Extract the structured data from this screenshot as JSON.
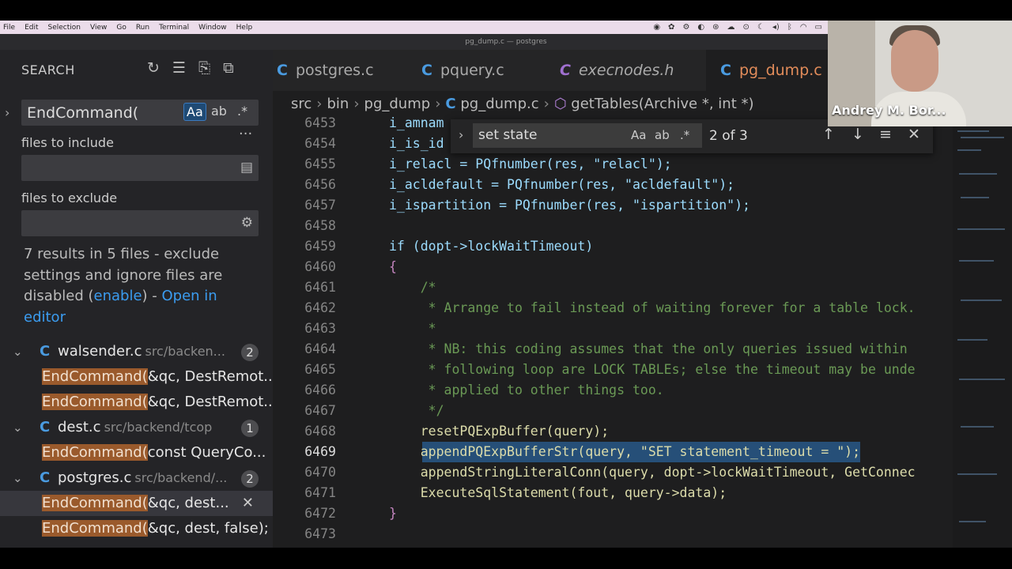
{
  "menubar": {
    "items": [
      "File",
      "Edit",
      "Selection",
      "View",
      "Go",
      "Run",
      "Terminal",
      "Window",
      "Help"
    ]
  },
  "window_title": "pg_dump.c — postgres",
  "sidebar": {
    "header": "SEARCH",
    "search_value": "EndCommand(",
    "match_case": "Aa",
    "whole_word": "ab",
    "regex": ".*",
    "files_to_include_label": "files to include",
    "files_to_exclude_label": "files to exclude",
    "message_prefix": "7 results in 5 files - exclude settings and ignore files are disabled (",
    "enable_link": "enable",
    "message_mid": ") - ",
    "open_link": "Open in editor",
    "results": [
      {
        "name": "walsender.c",
        "path": "src/backen...",
        "count": "2"
      },
      {
        "match_hl": "EndCommand(",
        "match_rest": "&qc, DestRemot..."
      },
      {
        "match_hl": "EndCommand(",
        "match_rest": "&qc, DestRemot..."
      },
      {
        "name": "dest.c",
        "path": "src/backend/tcop",
        "count": "1"
      },
      {
        "match_hl": "EndCommand(",
        "match_rest": "const QueryCo..."
      },
      {
        "name": "postgres.c",
        "path": "src/backend/...",
        "count": "2"
      },
      {
        "match_hl": "EndCommand(",
        "match_rest": "&qc, dest..."
      },
      {
        "match_hl": "EndCommand(",
        "match_rest": "&qc, dest, false);"
      }
    ]
  },
  "tabs": [
    {
      "icon": "C",
      "label": "postgres.c"
    },
    {
      "icon": "C",
      "label": "pquery.c"
    },
    {
      "icon": "C",
      "label": "execnodes.h"
    },
    {
      "icon": "C",
      "label": "pg_dump.c"
    }
  ],
  "breadcrumbs": {
    "parts": [
      "src",
      "bin",
      "pg_dump"
    ],
    "file_icon": "C",
    "file": "pg_dump.c",
    "symbol": "getTables(Archive *, int *)"
  },
  "find": {
    "query": "set state",
    "match_case": "Aa",
    "whole_word": "ab",
    "regex": ".*",
    "count": "2 of 3"
  },
  "code_lines": [
    {
      "n": "6453",
      "t": "i_amnam"
    },
    {
      "n": "6454",
      "t": "i_is_id"
    },
    {
      "n": "6455",
      "t": "i_relacl = PQfnumber(res, \"relacl\");"
    },
    {
      "n": "6456",
      "t": "i_acldefault = PQfnumber(res, \"acldefault\");"
    },
    {
      "n": "6457",
      "t": "i_ispartition = PQfnumber(res, \"ispartition\");"
    },
    {
      "n": "6458",
      "t": ""
    },
    {
      "n": "6459",
      "t": "if (dopt->lockWaitTimeout)"
    },
    {
      "n": "6460",
      "t": "{"
    },
    {
      "n": "6461",
      "t": "    /*"
    },
    {
      "n": "6462",
      "t": "     * Arrange to fail instead of waiting forever for a table lock."
    },
    {
      "n": "6463",
      "t": "     *"
    },
    {
      "n": "6464",
      "t": "     * NB: this coding assumes that the only queries issued within"
    },
    {
      "n": "6465",
      "t": "     * following loop are LOCK TABLEs; else the timeout may be unde"
    },
    {
      "n": "6466",
      "t": "     * applied to other things too."
    },
    {
      "n": "6467",
      "t": "     */"
    },
    {
      "n": "6468",
      "t": "    resetPQExpBuffer(query);"
    },
    {
      "n": "6469",
      "t": "    appendPQExpBufferStr(query, \"SET statement_timeout = \");"
    },
    {
      "n": "6470",
      "t": "    appendStringLiteralConn(query, dopt->lockWaitTimeout, GetConnec"
    },
    {
      "n": "6471",
      "t": "    ExecuteSqlStatement(fout, query->data);"
    },
    {
      "n": "6472",
      "t": "}"
    },
    {
      "n": "6473",
      "t": ""
    }
  ],
  "webcam": {
    "name": "Andrey M. Bor..."
  }
}
